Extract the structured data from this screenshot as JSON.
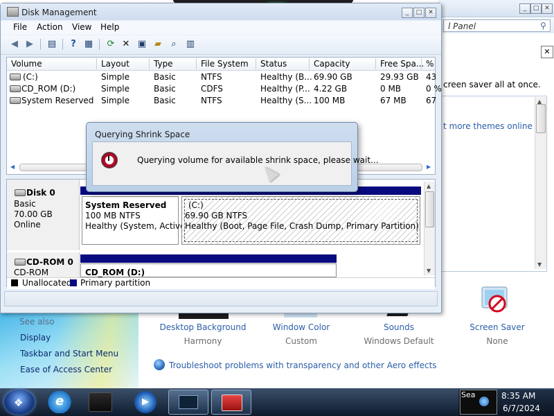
{
  "control_panel": {
    "address": "l Panel",
    "screensaver_hint": "creen saver all at once.",
    "more_themes": "t more themes online",
    "see_also": "See also",
    "left_links": [
      "Display",
      "Taskbar and Start Menu",
      "Ease of Access Center"
    ],
    "items": [
      {
        "label": "Desktop Background",
        "value": "Harmony"
      },
      {
        "label": "Window Color",
        "value": "Custom"
      },
      {
        "label": "Sounds",
        "value": "Windows Default"
      },
      {
        "label": "Screen Saver",
        "value": "None"
      }
    ],
    "troubleshoot": "Troubleshoot problems with transparency and other Aero effects"
  },
  "disk_management": {
    "title": "Disk Management",
    "menu": [
      "File",
      "Action",
      "View",
      "Help"
    ],
    "columns": [
      "Volume",
      "Layout",
      "Type",
      "File System",
      "Status",
      "Capacity",
      "Free Spa...",
      "%"
    ],
    "volumes": [
      {
        "volume": "(C:)",
        "layout": "Simple",
        "type": "Basic",
        "fs": "NTFS",
        "status": "Healthy (B...",
        "capacity": "69.90 GB",
        "free": "29.93 GB",
        "pct": "43"
      },
      {
        "volume": "CD_ROM (D:)",
        "layout": "Simple",
        "type": "Basic",
        "fs": "CDFS",
        "status": "Healthy (P...",
        "capacity": "4.22 GB",
        "free": "0 MB",
        "pct": "0 %"
      },
      {
        "volume": "System Reserved",
        "layout": "Simple",
        "type": "Basic",
        "fs": "NTFS",
        "status": "Healthy (S...",
        "capacity": "100 MB",
        "free": "67 MB",
        "pct": "67"
      }
    ],
    "disk0": {
      "name": "Disk 0",
      "type": "Basic",
      "size": "70.00 GB",
      "state": "Online",
      "partitions": [
        {
          "name": "System Reserved",
          "size": "100 MB NTFS",
          "status": "Healthy (System, Active,"
        },
        {
          "name": "(C:)",
          "size": "69.90 GB NTFS",
          "status": "Healthy (Boot, Page File, Crash Dump, Primary Partition)"
        }
      ]
    },
    "cdrom0": {
      "name": "CD-ROM 0",
      "type": "CD-ROM",
      "partition": "CD_ROM  (D:)"
    },
    "legend": [
      "Unallocated",
      "Primary partition"
    ]
  },
  "dialog": {
    "title": "Querying Shrink Space",
    "message": "Querying volume for available shrink space, please wait..."
  },
  "taskbar": {
    "time": "8:35 AM",
    "date": "6/7/2024",
    "tray_text": "Sea"
  },
  "colors": {
    "primary_partition": "#0a0a80",
    "link": "#2a5ea8"
  }
}
